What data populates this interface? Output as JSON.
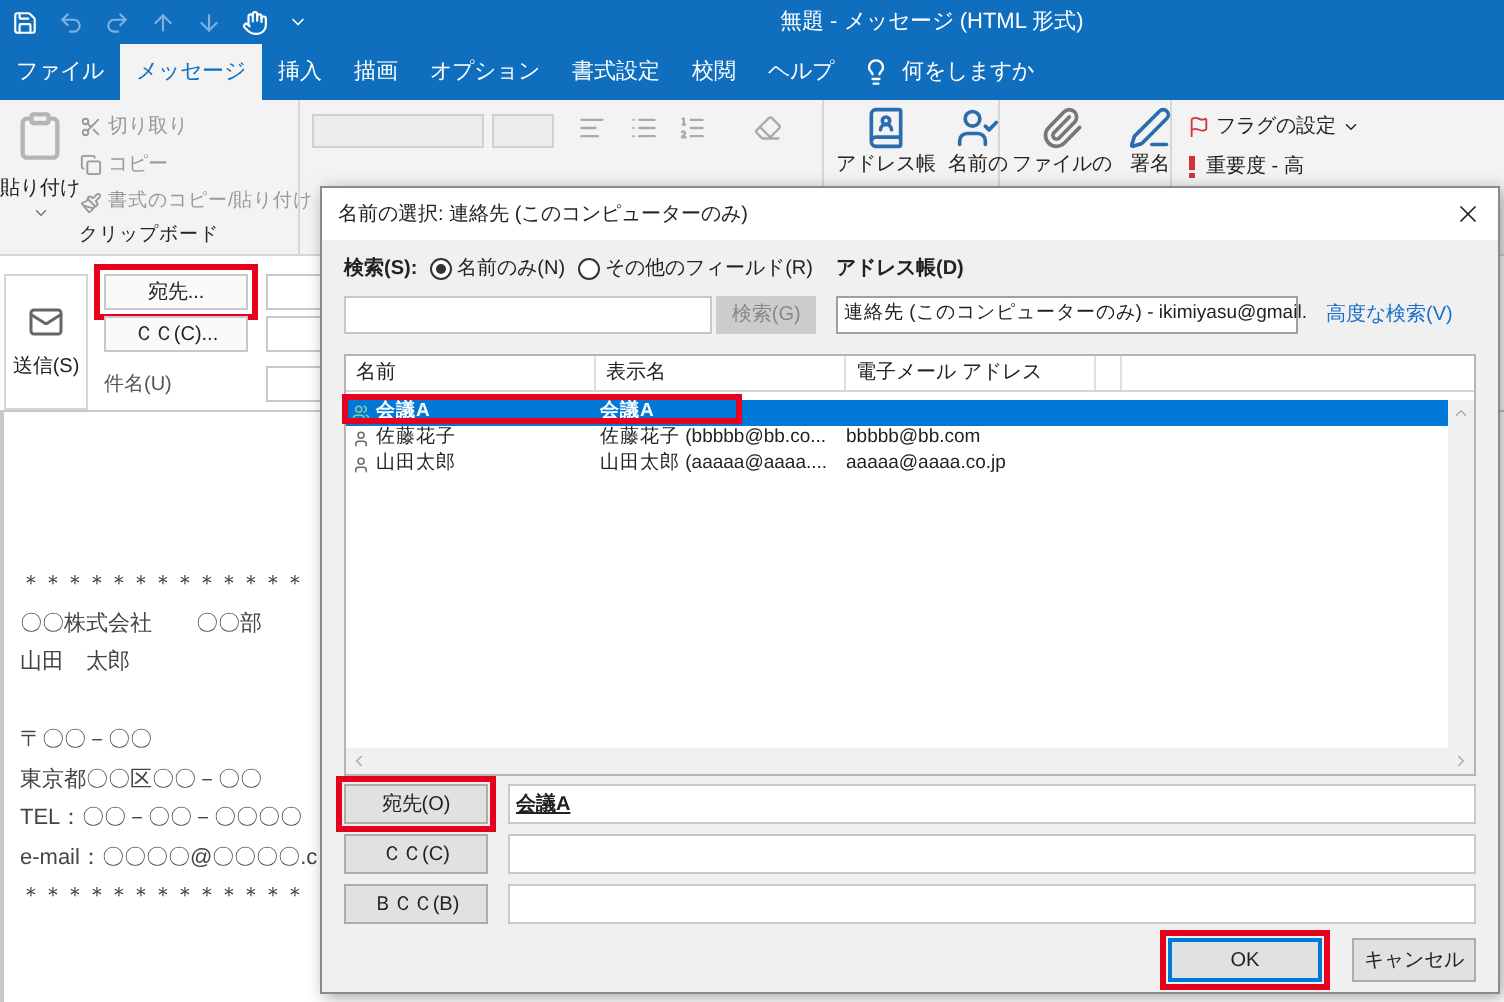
{
  "window": {
    "title": "無題 - メッセージ (HTML 形式)"
  },
  "ribbon_tabs": [
    {
      "label": "ファイル",
      "selected": false
    },
    {
      "label": "メッセージ",
      "selected": true
    },
    {
      "label": "挿入",
      "selected": false
    },
    {
      "label": "描画",
      "selected": false
    },
    {
      "label": "オプション",
      "selected": false
    },
    {
      "label": "書式設定",
      "selected": false
    },
    {
      "label": "校閲",
      "selected": false
    },
    {
      "label": "ヘルプ",
      "selected": false
    }
  ],
  "tell_me": "何をしますか",
  "ribbon": {
    "paste": "貼り付け",
    "cut": "切り取り",
    "copy": "コピー",
    "format_painter": "書式のコピー/貼り付け",
    "clipboard_label": "クリップボード",
    "address_book": "アドレス帳",
    "check_names": "名前の",
    "attach_file": "ファイルの",
    "signature": "署名",
    "follow_up": "フラグの設定",
    "high_importance": "重要度 - 高"
  },
  "compose": {
    "send": "送信(S)",
    "to_button": {
      "label": "宛先...",
      "highlighted": true
    },
    "cc_button": {
      "label": "ＣＣ(C)...",
      "highlighted": false
    },
    "subject_label": "件名(U)",
    "body_paragraphs": [
      [
        "＊＊＊＊＊＊＊＊＊＊＊＊＊",
        "〇〇株式会社　　〇〇部",
        "山田　太郎"
      ],
      [
        "〒〇〇－〇〇",
        "東京都〇〇区〇〇－〇〇",
        "TEL：〇〇－〇〇－〇〇〇〇",
        "e-mail：〇〇〇〇@〇〇〇〇.c",
        "＊＊＊＊＊＊＊＊＊＊＊＊＊"
      ]
    ]
  },
  "dialog": {
    "title": "名前の選択: 連絡先 (このコンピューターのみ)",
    "search_label": "検索(S):",
    "search_options": [
      {
        "label": "名前のみ(N)",
        "selected": true
      },
      {
        "label": "その他のフィールド(R)",
        "selected": false
      }
    ],
    "search_button": {
      "label": "検索(G)",
      "disabled": true
    },
    "address_book_label": "アドレス帳(D)",
    "address_book_value": "連絡先 (このコンピューターのみ) - ikimiyasu@gmail.",
    "advanced_search": "高度な検索(V)",
    "columns": [
      "名前",
      "表示名",
      "電子メール アドレス"
    ],
    "rows": [
      {
        "kind": "group",
        "name": "会議A",
        "display_name": "会議A",
        "selected": true,
        "highlighted": true
      },
      {
        "kind": "person",
        "name": "佐藤花子",
        "display_name": "佐藤花子 (bbbbb@bb.co...",
        "email": "bbbbb@bb.com",
        "selected": false,
        "highlighted": false
      },
      {
        "kind": "person",
        "name": "山田太郎",
        "display_name": "山田太郎 (aaaaa@aaaa....",
        "email": "aaaaa@aaaa.co.jp",
        "selected": false,
        "highlighted": false
      }
    ],
    "recipients": [
      {
        "label": "宛先(O)",
        "value": "会議A",
        "highlighted": true
      },
      {
        "label": "ＣＣ(C)",
        "highlighted": false
      },
      {
        "label": "ＢＣＣ(B)",
        "highlighted": false
      }
    ],
    "buttons": [
      {
        "label": "OK",
        "highlighted": true,
        "default": true
      },
      {
        "label": "キャンセル",
        "highlighted": false,
        "default": false
      }
    ]
  }
}
